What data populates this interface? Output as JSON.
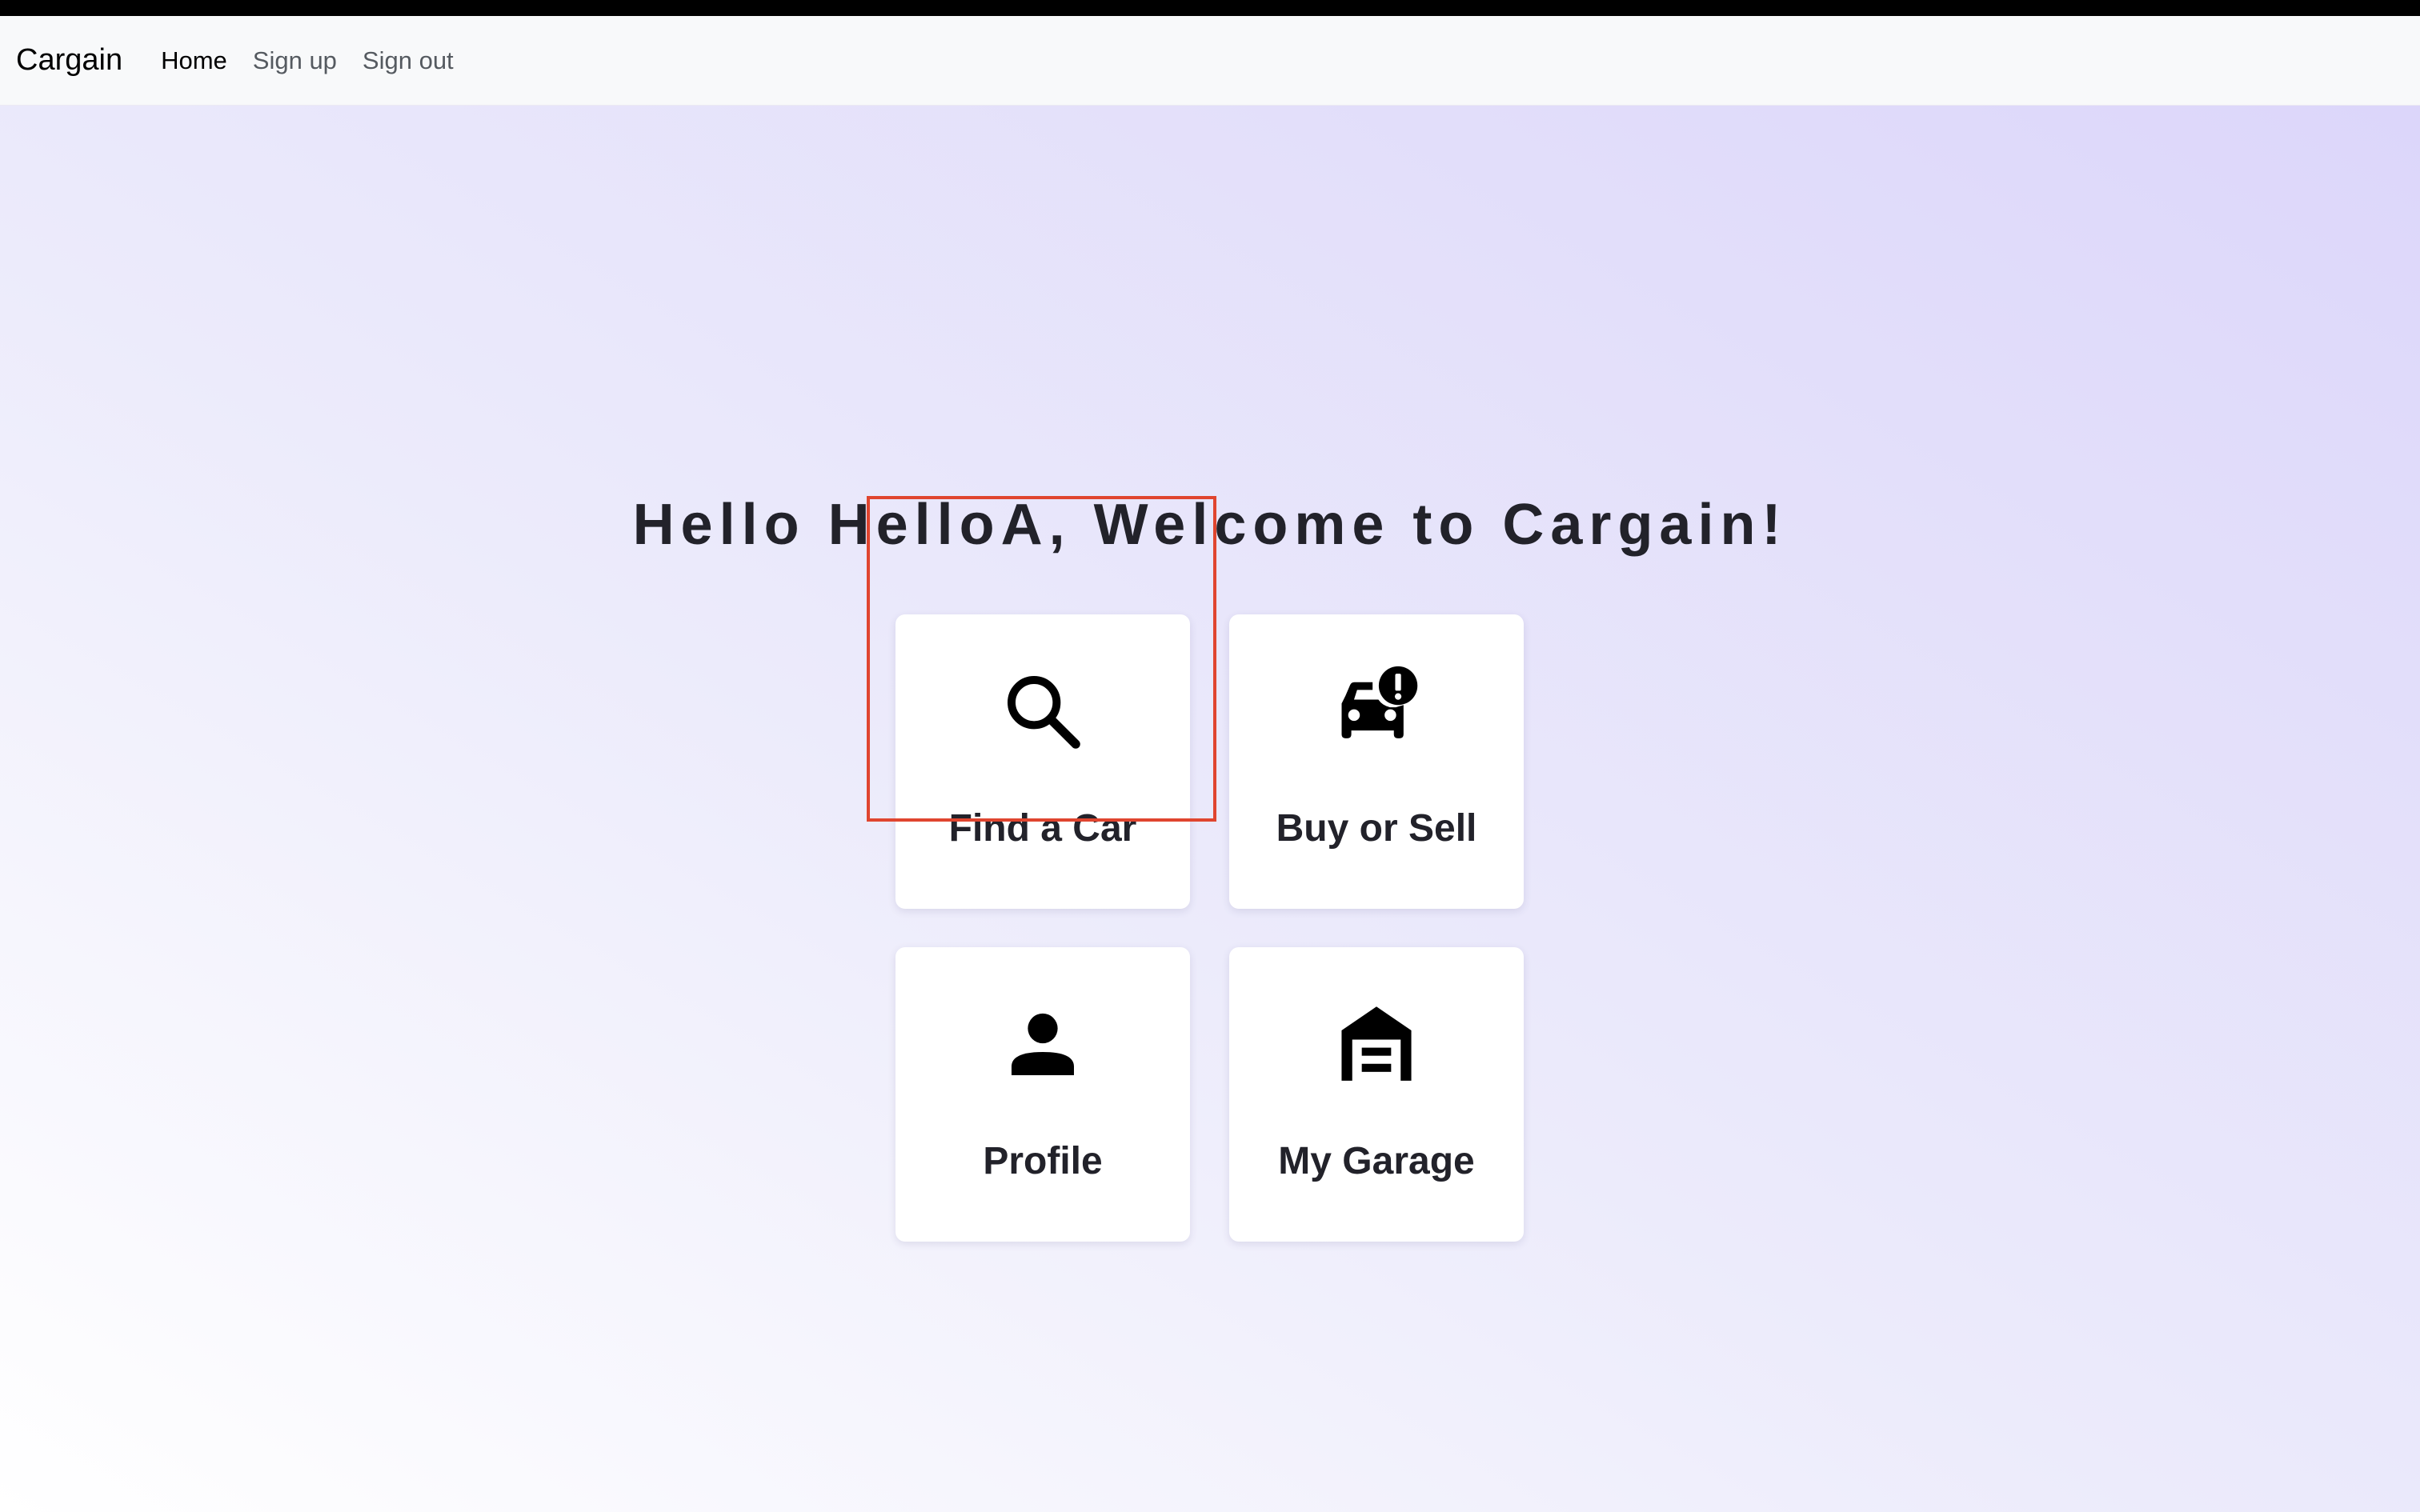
{
  "navbar": {
    "brand": "Cargain",
    "links": [
      {
        "label": "Home",
        "active": true
      },
      {
        "label": "Sign up",
        "active": false
      },
      {
        "label": "Sign out",
        "active": false
      }
    ]
  },
  "main": {
    "welcome": "Hello HelloA, Welcome to Cargain!",
    "tiles": [
      {
        "label": "Find a Car",
        "icon": "search-icon",
        "highlighted": true
      },
      {
        "label": "Buy or Sell",
        "icon": "car-alert-icon",
        "highlighted": false
      },
      {
        "label": "Profile",
        "icon": "person-icon",
        "highlighted": false
      },
      {
        "label": "My Garage",
        "icon": "garage-icon",
        "highlighted": false
      }
    ]
  },
  "colors": {
    "text": "#22222a",
    "navbar_bg": "#f8f9fa",
    "highlight_border": "#e0452f",
    "gradient_light": "#ffffff",
    "gradient_dark": "#dcd6fa"
  }
}
